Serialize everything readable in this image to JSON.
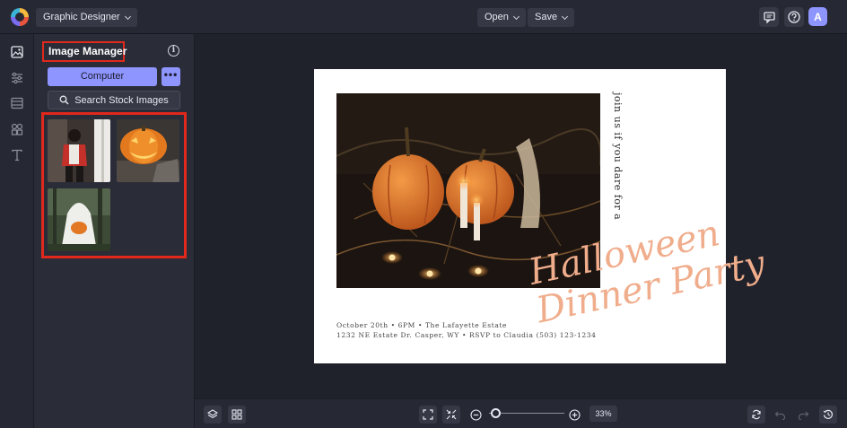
{
  "topbar": {
    "app_menu_label": "Graphic Designer",
    "open_label": "Open",
    "save_label": "Save",
    "avatar_initial": "A",
    "icons": [
      "comment-icon",
      "help-icon"
    ]
  },
  "rail": {
    "items": [
      "image-icon",
      "adjust-icon",
      "layout-icon",
      "graphics-icon",
      "text-icon"
    ]
  },
  "panel": {
    "title": "Image Manager",
    "info_icon": "i",
    "computer_label": "Computer",
    "more_label": "•••",
    "stock_label": "Search Stock Images",
    "thumbnails": [
      "woman-red-jacket",
      "jack-o-lantern",
      "ghost-with-pumpkin"
    ]
  },
  "card": {
    "vertical_text": "join us if you dare for a",
    "script_line1": "Halloween",
    "script_line2": "Dinner Party",
    "line1": "October 20th • 6PM • The Lafayette Estate",
    "line2": "1232 NE Estate Dr. Casper, WY • RSVP to Claudia (503) 123-1234"
  },
  "bottombar": {
    "zoom_percent": "33%",
    "zoom_level": 0.05
  },
  "colors": {
    "accent": "#8e95ff",
    "highlight": "#e0281c",
    "script": "#f0ad8c"
  }
}
